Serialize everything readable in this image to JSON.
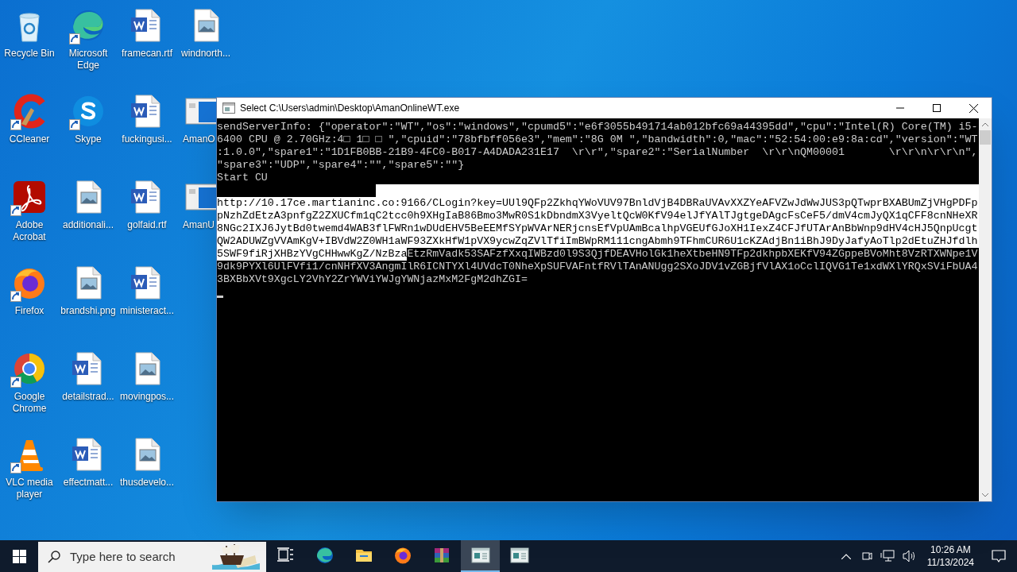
{
  "desktop_icons": [
    {
      "label": "Recycle Bin",
      "kind": "recycle",
      "shortcut": false
    },
    {
      "label": "CCleaner",
      "kind": "ccleaner",
      "shortcut": true
    },
    {
      "label": "Adobe Acrobat",
      "kind": "acrobat",
      "shortcut": true
    },
    {
      "label": "Firefox",
      "kind": "firefox",
      "shortcut": true
    },
    {
      "label": "Google Chrome",
      "kind": "chrome",
      "shortcut": true
    },
    {
      "label": "VLC media player",
      "kind": "vlc",
      "shortcut": true
    },
    {
      "label": "Microsoft Edge",
      "kind": "edge",
      "shortcut": true
    },
    {
      "label": "Skype",
      "kind": "skype",
      "shortcut": true
    },
    {
      "label": "additionali...",
      "kind": "image",
      "shortcut": false
    },
    {
      "label": "brandshi.png",
      "kind": "image",
      "shortcut": false
    },
    {
      "label": "detailstrad...",
      "kind": "word",
      "shortcut": false
    },
    {
      "label": "effectmatt...",
      "kind": "word",
      "shortcut": false
    },
    {
      "label": "framecan.rtf",
      "kind": "word",
      "shortcut": false
    },
    {
      "label": "fuckingusi...",
      "kind": "word",
      "shortcut": false
    },
    {
      "label": "golfaid.rtf",
      "kind": "word",
      "shortcut": false
    },
    {
      "label": "ministeract...",
      "kind": "word",
      "shortcut": false
    },
    {
      "label": "movingpos...",
      "kind": "image",
      "shortcut": false
    },
    {
      "label": "thusdevelo...",
      "kind": "image",
      "shortcut": false
    },
    {
      "label": "windnorth...",
      "kind": "image",
      "shortcut": false
    },
    {
      "label": "AmanO",
      "kind": "app",
      "shortcut": false,
      "truncated_by_window": true
    },
    {
      "label": "AmanU",
      "kind": "app",
      "shortcut": false,
      "truncated_by_window": true
    }
  ],
  "console": {
    "title": "Select C:\\Users\\admin\\Desktop\\AmanOnlineWT.exe",
    "cursor": true,
    "lines": [
      {
        "kind": "text",
        "segments": [
          {
            "text": "sendServerInfo: {\"operator\":\"WT\",\"os\":\"windows\",\"cpumd5\":\"e6f3055b491714ab012bfc69a44395dd\",\"cpu\":\"Intel(R) Core(TM) i5-",
            "selected": false
          }
        ]
      },
      {
        "kind": "text",
        "segments": [
          {
            "text": "6400 CPU @ 2.70GHz:4□ 1□ □ \",\"cpuid\":\"78bfbff056e3\",\"mem\":\"8G 0M \",\"bandwidth\":0,\"mac\":\"52:54:00:e9:8a:cd\",\"version\":\"WT",
            "selected": false
          }
        ]
      },
      {
        "kind": "text",
        "segments": [
          {
            "text": ":1.0.0\",\"spare1\":\"1D1FB0BB-21B9-4FC0-B017-A4DADA231E17  \\r\\r\",\"spare2\":\"SerialNumber  \\r\\r\\nQM00001       \\r\\r\\n\\r\\r\\n\",",
            "selected": false
          }
        ]
      },
      {
        "kind": "text",
        "segments": [
          {
            "text": "\"spare3\":\"UDP\",\"spare4\":\"\",\"spare5\":\"\"}",
            "selected": false
          }
        ]
      },
      {
        "kind": "text",
        "segments": [
          {
            "text": "Start CU",
            "selected": false
          }
        ]
      },
      {
        "kind": "blank",
        "selected": true
      },
      {
        "kind": "text",
        "segments": [
          {
            "text": "http://10.17ce.martianinc.co:9166/CLogin?key=UUl9QFp2ZkhqYWoVUV97BnldVjB4DBRaUVAvXXZYeAFVZwJdWwJUS3pQTwprBXABUmZjVHgPDFp",
            "selected": true
          }
        ]
      },
      {
        "kind": "text",
        "segments": [
          {
            "text": "pNzhZdEtzA3pnfgZ2ZXUCfm1qC2tcc0h9XHgIaB86Bmo3MwR0S1kDbndmX3VyeltQcW0KfV94elJfYAlTJgtgeDAgcFsCeF5/dmV4cmJyQX1qCFF8cnNHeXR",
            "selected": true
          }
        ]
      },
      {
        "kind": "text",
        "segments": [
          {
            "text": "8NGc2IXJ6JytBd0twemd4WAB3flFWRn1wDUdEHV5BeEEMfSYpWVArNERjcnsEfVpUAmBcalhpVGEUfGJoXH1IexZ4CFJfUTArAnBbWnp9dHV4cHJ5QnpUcgt",
            "selected": true
          }
        ]
      },
      {
        "kind": "text",
        "segments": [
          {
            "text": "QW2ADUWZgVVAmKgV+IBVdW2Z0WH1aWF93ZXkHfW1pVX9ycwZqZVlTfiImBWpRM111cngAbmh9TFhmCUR6U1cKZAdjBn1iBhJ9DyJafyAoTlp2dEtuZHJfdlh",
            "selected": true
          }
        ]
      },
      {
        "kind": "text",
        "segments": [
          {
            "text": "5SWF9fiRjXHBzYVgCHHwwKgZ/NzBza",
            "selected": true
          },
          {
            "text": "EtzRmVadk53SAFzfXxqIWBzd0l9S3QjfDEAVHolGk1heXtbeHN9TFp2dkhpbXEKfV94ZGppeBVoMht8VzRTXWNpe1V",
            "selected": false
          }
        ]
      },
      {
        "kind": "text",
        "segments": [
          {
            "text": "9dk9PYXl6UlFVfi1/cnNHfXV3AngmIlR6ICNTYXl4UVdcT0NheXpSUFVAFntfRVlTAnANUgg2SXoJDV1vZGBjfVlAX1oCclIQVG1Te1xdWXlYRQxSViFbUA4",
            "selected": false
          }
        ]
      },
      {
        "kind": "text",
        "segments": [
          {
            "text": "3BXBbXVt9XgcLY2VhY2ZrYWViYWJgYWNjazMxM2FgM2dhZGI=",
            "selected": false
          }
        ]
      }
    ]
  },
  "taskbar": {
    "search": {
      "placeholder": "Type here to search"
    },
    "apps": [
      {
        "kind": "taskview",
        "selected": false
      },
      {
        "kind": "edge",
        "selected": false
      },
      {
        "kind": "explorer",
        "selected": false
      },
      {
        "kind": "firefox",
        "selected": false
      },
      {
        "kind": "winrar",
        "selected": false
      },
      {
        "kind": "console",
        "selected": true
      },
      {
        "kind": "console",
        "selected": false
      }
    ],
    "clock": {
      "time": "10:26 AM",
      "date": "11/13/2024"
    }
  }
}
